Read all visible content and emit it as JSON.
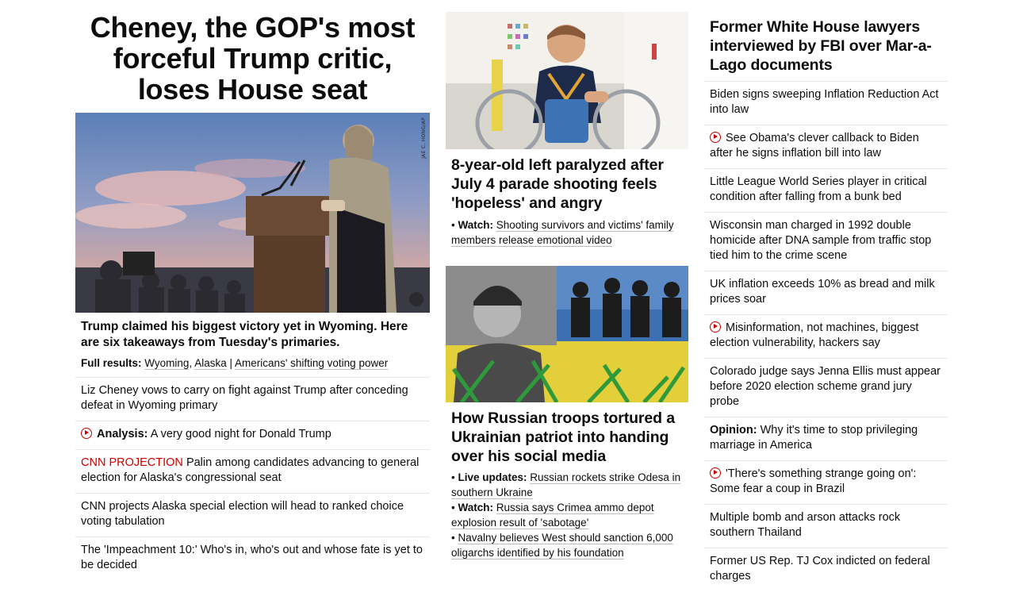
{
  "left": {
    "hero_headline": "Cheney, the GOP's most forceful Trump critic, loses House seat",
    "hero_image_credit": "JAE C. HONG/AP",
    "bold_headline": "Trump claimed his biggest victory yet in Wyoming. Here are six takeaways from Tuesday's primaries.",
    "full_results": {
      "label": "Full results:",
      "link1": "Wyoming",
      "comma": ",",
      "link2": "Alaska",
      "pipe": "|",
      "link3": "Americans' shifting voting power"
    },
    "items": [
      {
        "text": "Liz Cheney vows to carry on fight against Trump after conceding defeat in Wyoming primary"
      },
      {
        "label": "Analysis:",
        "text": "A very good night for Donald Trump",
        "icon": "play-icon"
      },
      {
        "label": "CNN PROJECTION",
        "text": "Palin among candidates advancing to general election for Alaska's congressional seat"
      },
      {
        "text": "CNN projects Alaska special election will head to ranked choice voting tabulation"
      },
      {
        "text": "The 'Impeachment 10:' Who's in, who's out and whose fate is yet to be decided"
      }
    ]
  },
  "middle": {
    "story1": {
      "headline": "8-year-old left paralyzed after July 4 parade shooting feels 'hopeless' and angry",
      "sub": {
        "bullet": "•",
        "label": "Watch:",
        "text": "Shooting survivors and victims' family members release emotional video"
      }
    },
    "story2": {
      "headline": "How Russian troops tortured a Ukrainian patriot into handing over his social media",
      "subs": [
        {
          "bullet": "•",
          "label": "Live updates:",
          "text": "Russian rockets strike Odesa in southern Ukraine"
        },
        {
          "bullet": "•",
          "label": "Watch:",
          "text": "Russia says Crimea ammo depot explosion result of 'sabotage'"
        },
        {
          "bullet": "•",
          "label": "",
          "text": "Navalny believes West should sanction 6,000 oligarchs identified by his foundation"
        }
      ]
    }
  },
  "right": {
    "headline": "Former White House lawyers interviewed by FBI over Mar-a-Lago documents",
    "items": [
      {
        "text": "Biden signs sweeping Inflation Reduction Act into law"
      },
      {
        "text": "See Obama's clever callback to Biden after he signs inflation bill into law",
        "icon": "play-icon"
      },
      {
        "text": "Little League World Series player in critical condition after falling from a bunk bed"
      },
      {
        "text": "Wisconsin man charged in 1992 double homicide after DNA sample from traffic stop tied him to the crime scene"
      },
      {
        "text": "UK inflation exceeds 10% as bread and milk prices soar"
      },
      {
        "text": "Misinformation, not machines, biggest election vulnerability, hackers say",
        "icon": "play-icon"
      },
      {
        "text": "Colorado judge says Jenna Ellis must appear before 2020 election scheme grand jury probe"
      },
      {
        "label": "Opinion:",
        "text": "Why it's time to stop privileging marriage in America"
      },
      {
        "text": "'There's something strange going on': Some fear a coup in Brazil",
        "icon": "play-icon"
      },
      {
        "text": "Multiple bomb and arson attacks rock southern Thailand"
      },
      {
        "text": "Former US Rep. TJ Cox indicted on federal charges"
      }
    ]
  },
  "colors": {
    "accent_red": "#cc0000",
    "text": "#0c0c0c",
    "divider": "#e6e6e6"
  }
}
